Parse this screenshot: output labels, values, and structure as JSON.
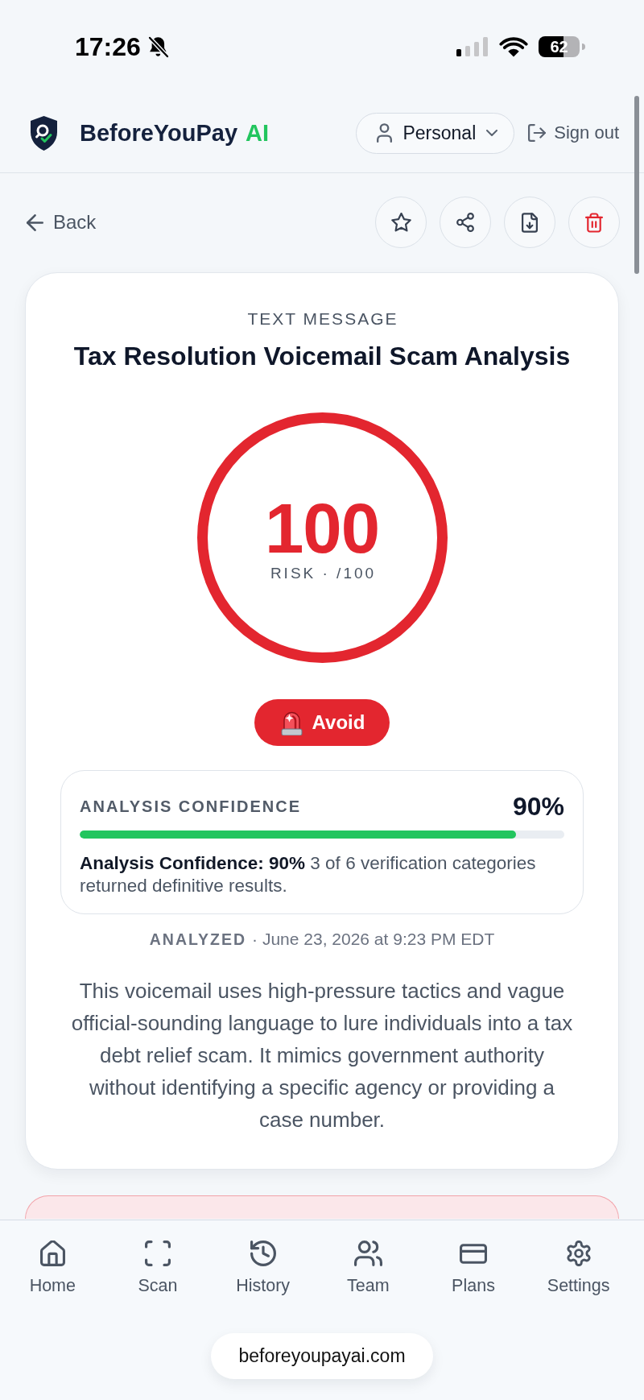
{
  "status_bar": {
    "time": "17:26",
    "battery": "62"
  },
  "header": {
    "brand": {
      "name": "BeforeYouPay",
      "suffix": "AI"
    },
    "account_menu": {
      "label": "Personal"
    },
    "sign_out": {
      "label": "Sign out"
    }
  },
  "toolbar": {
    "back": {
      "label": "Back"
    },
    "actions": [
      {
        "kind": "favorite"
      },
      {
        "kind": "share"
      },
      {
        "kind": "export"
      },
      {
        "kind": "delete"
      }
    ]
  },
  "report": {
    "source_type": "TEXT MESSAGE",
    "title": "Tax Resolution Voicemail Scam Analysis",
    "risk": {
      "score": "100",
      "caption": "RISK · /100",
      "level": 1
    },
    "verdict": {
      "kind": "danger",
      "label": "Avoid"
    },
    "confidence": {
      "label": "ANALYSIS CONFIDENCE",
      "value": "90%",
      "level": 0.9,
      "note": "**Analysis Confidence: 90%** 3 of 6 verification categories returned definitive results."
    },
    "analyzed": {
      "label": "ANALYZED",
      "date": "· June 23, 2026 at 9:23 PM EDT"
    },
    "summary": "This voicemail uses high-pressure tactics and vague official-sounding language to lure individuals into a tax debt relief scam. It mimics government authority without identifying a specific agency or providing a case number."
  },
  "bottom_nav": [
    {
      "kind": "home",
      "label": "Home"
    },
    {
      "kind": "scan",
      "label": "Scan"
    },
    {
      "kind": "history",
      "label": "History"
    },
    {
      "kind": "team",
      "label": "Team"
    },
    {
      "kind": "plans",
      "label": "Plans"
    },
    {
      "kind": "settings",
      "label": "Settings"
    }
  ],
  "browser": {
    "url": "beforeyoupayai.com"
  }
}
